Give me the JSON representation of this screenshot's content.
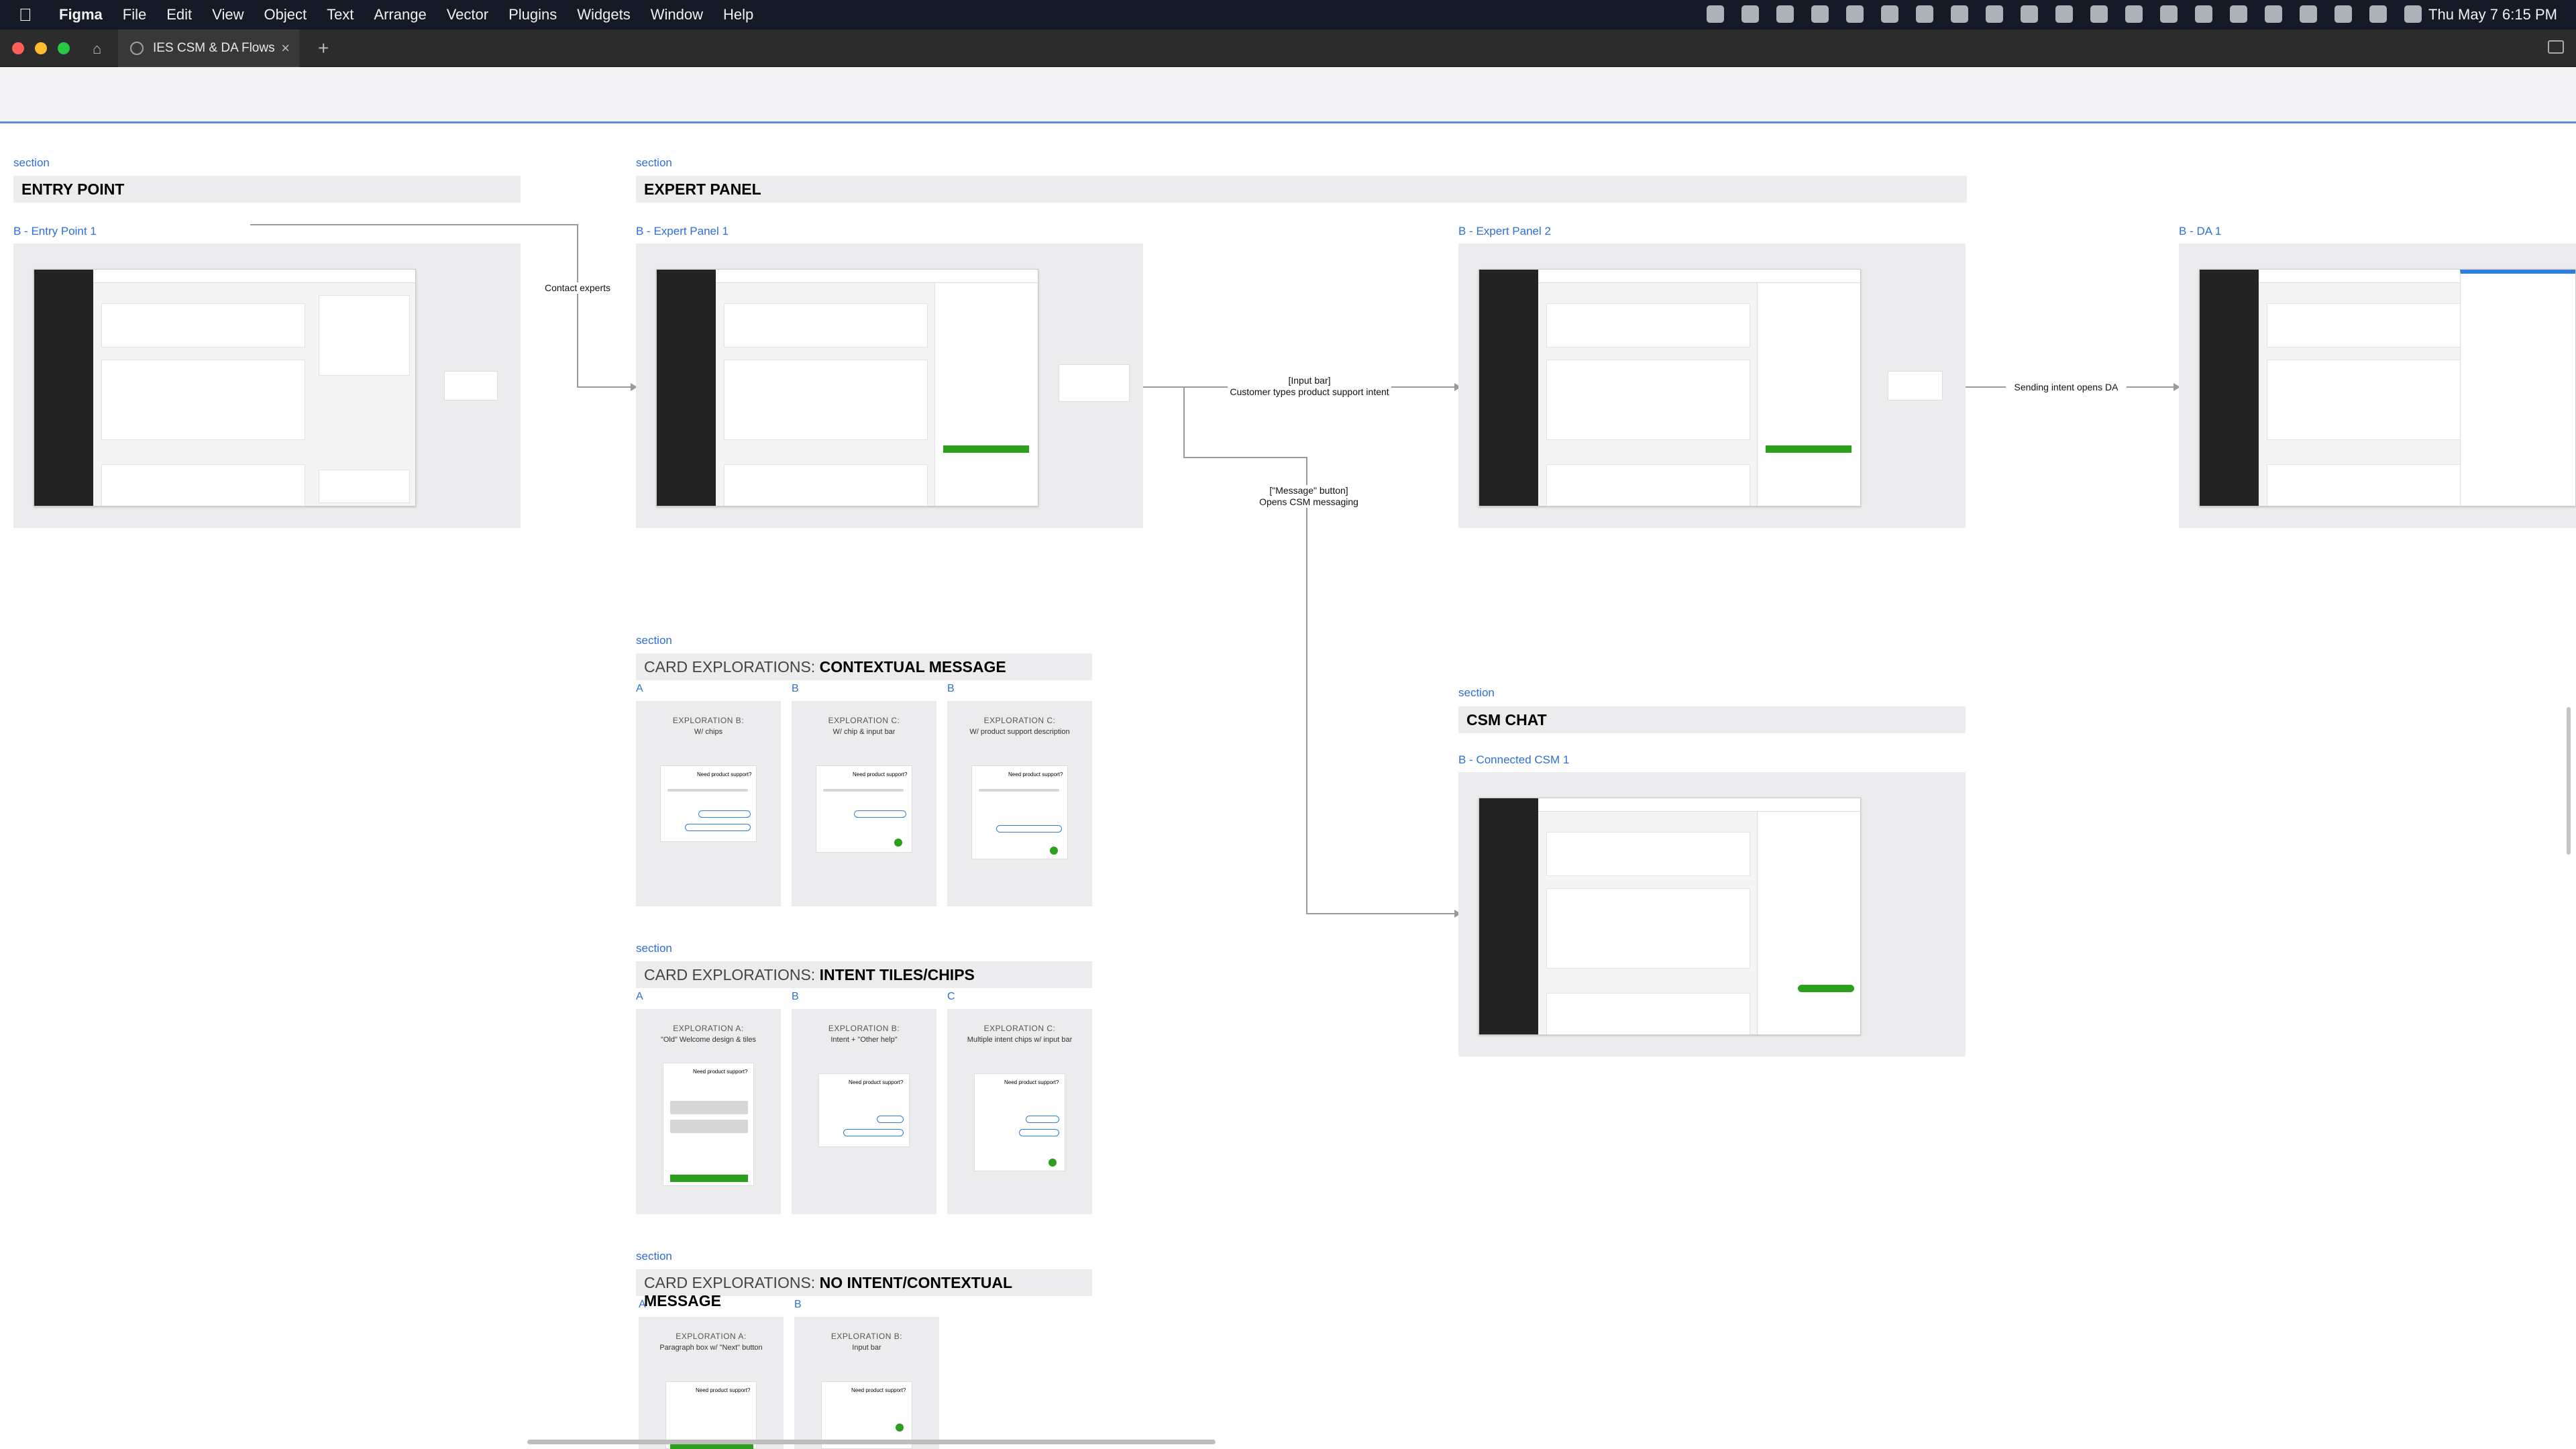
{
  "menubar": {
    "app_name": "Figma",
    "menus": [
      "File",
      "Edit",
      "View",
      "Object",
      "Text",
      "Arrange",
      "Vector",
      "Plugins",
      "Widgets",
      "Window",
      "Help"
    ],
    "clock": "Thu May 7  6:15 PM"
  },
  "tab": {
    "title": "IES CSM & DA Flows"
  },
  "sections": {
    "entry": {
      "label": "section",
      "title": "ENTRY POINT",
      "frame": "B - Entry Point 1"
    },
    "expert": {
      "label": "section",
      "title": "EXPERT PANEL",
      "frame1": "B - Expert Panel 1",
      "frame2": "B - Expert Panel 2",
      "frame3": "B - DA 1"
    },
    "contextual": {
      "label": "section",
      "title_light": "CARD EXPLORATIONS: ",
      "title_bold": "CONTEXTUAL MESSAGE"
    },
    "intent": {
      "label": "section",
      "title_light": "CARD EXPLORATIONS: ",
      "title_bold": "INTENT TILES/CHIPS"
    },
    "nointent": {
      "label": "section",
      "title_light": "CARD EXPLORATIONS: ",
      "title_bold": "NO INTENT/CONTEXTUAL MESSAGE"
    },
    "csm": {
      "label": "section",
      "title": "CSM CHAT",
      "frame": "B - Connected CSM 1"
    }
  },
  "flows": {
    "contact_experts": "Contact experts",
    "input_bar_line1": "[Input bar]",
    "input_bar_line2": "Customer types product support intent",
    "sending_intent": "Sending intent opens DA",
    "message_btn_line1": "[\"Message\" button]",
    "message_btn_line2": "Opens CSM messaging"
  },
  "contextual_cards": [
    {
      "tag": "A",
      "title": "EXPLORATION B:",
      "subtitle": "W/ chips"
    },
    {
      "tag": "B",
      "title": "EXPLORATION C:",
      "subtitle": "W/ chip & input bar"
    },
    {
      "tag": "B",
      "title": "EXPLORATION C:",
      "subtitle": "W/ product support description"
    }
  ],
  "intent_cards": [
    {
      "tag": "A",
      "title": "EXPLORATION A:",
      "subtitle": "\"Old\" Welcome design & tiles"
    },
    {
      "tag": "B",
      "title": "EXPLORATION B:",
      "subtitle": "Intent + \"Other help\""
    },
    {
      "tag": "C",
      "title": "EXPLORATION C:",
      "subtitle": "Multiple intent chips w/ input bar"
    }
  ],
  "nointent_cards": [
    {
      "tag": "A",
      "title": "EXPLORATION A:",
      "subtitle": "Paragraph box w/ \"Next\" button"
    },
    {
      "tag": "B",
      "title": "EXPLORATION B:",
      "subtitle": "Input bar"
    }
  ],
  "mini_card": {
    "heading": "Need product support?"
  },
  "colors": {
    "accent": "#2f6ed8",
    "green": "#2ca01c",
    "sidebar": "#232323"
  }
}
